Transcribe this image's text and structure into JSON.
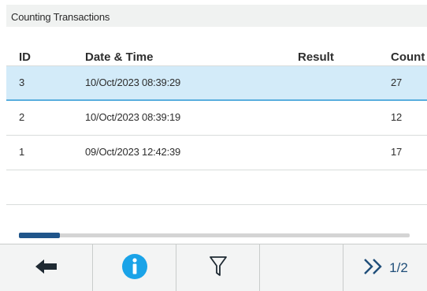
{
  "title": "Counting Transactions",
  "columns": {
    "id": "ID",
    "datetime": "Date & Time",
    "result": "Result",
    "count": "Count"
  },
  "rows": [
    {
      "id": "3",
      "datetime": "10/Oct/2023  08:39:29",
      "result": "",
      "count": "27",
      "selected": true
    },
    {
      "id": "2",
      "datetime": "10/Oct/2023  08:39:19",
      "result": "",
      "count": "12",
      "selected": false
    },
    {
      "id": "1",
      "datetime": "09/Oct/2023  12:42:39",
      "result": "",
      "count": "17",
      "selected": false
    }
  ],
  "scroll": {
    "position_fraction": 0.0,
    "visible_fraction": 0.1
  },
  "toolbar": {
    "back_icon": "arrow-left-icon",
    "info_icon": "info-icon",
    "filter_icon": "filter-icon",
    "next_icon": "double-chevron-right-icon",
    "page": "1/2"
  },
  "colors": {
    "selected_row": "#d3ebf9",
    "selected_border": "#5aaede",
    "accent": "#1f4e79",
    "info_blue": "#1aa3e8"
  }
}
